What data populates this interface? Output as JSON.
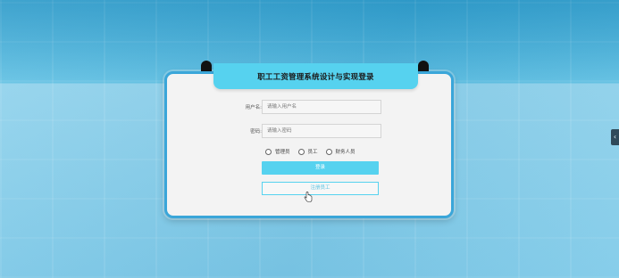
{
  "login": {
    "title": "职工工资管理系统设计与实现登录",
    "username_label": "用户名:",
    "username_placeholder": "请输入用户名",
    "password_label": "密码:",
    "password_placeholder": "请输入密码",
    "roles": [
      "管理员",
      "员工",
      "财务人员"
    ],
    "login_button": "登录",
    "register_button": "注册员工"
  },
  "side_tab": {
    "glyph": "‹"
  },
  "colors": {
    "accent": "#56d2ef",
    "border": "#3aa6d9",
    "card": "#f3f3f3"
  }
}
